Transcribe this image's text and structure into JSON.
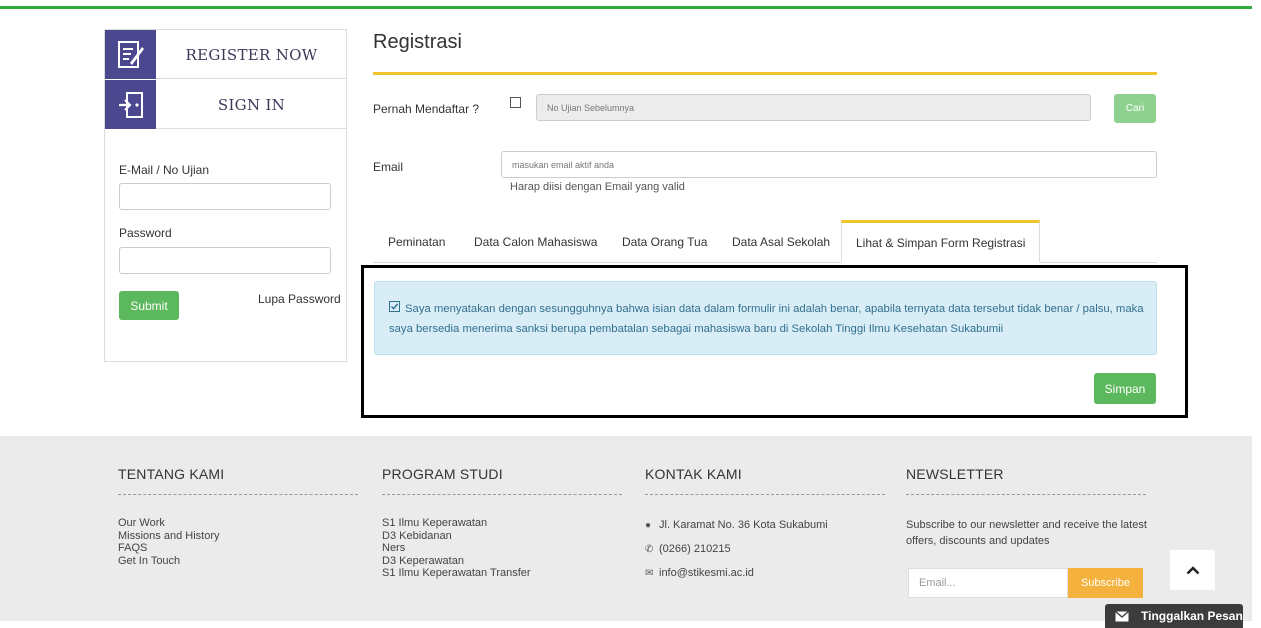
{
  "sidebar": {
    "register_label": "REGISTER NOW",
    "signin_label": "SIGN IN",
    "email_label": "E-Mail / No Ujian",
    "email_value": "",
    "password_label": "Password",
    "password_value": "",
    "submit_label": "Submit",
    "forgot_label": "Lupa Password"
  },
  "main": {
    "title": "Registrasi",
    "pernah_label": "Pernah Mendaftar ?",
    "pernah_checked": false,
    "no_ujian_placeholder": "No Ujian Sebelumnya",
    "cari_label": "Cari",
    "email_label": "Email",
    "email_placeholder": "masukan email aktif anda",
    "email_hint": "Harap diisi dengan Email yang valid",
    "tabs": [
      {
        "label": "Peminatan",
        "active": false
      },
      {
        "label": "Data Calon Mahasiswa",
        "active": false
      },
      {
        "label": "Data Orang Tua",
        "active": false
      },
      {
        "label": "Data Asal Sekolah",
        "active": false
      },
      {
        "label": "Lihat & Simpan Form Registrasi",
        "active": true
      }
    ],
    "declaration_checked": true,
    "declaration_text": "Saya menyatakan dengan sesungguhnya bahwa isian data dalam formulir ini adalah benar, apabila ternyata data tersebut tidak benar / palsu, maka saya bersedia menerima sanksi berupa pembatalan sebagai mahasiswa baru di Sekolah Tinggi Ilmu Kesehatan Sukabumii",
    "simpan_label": "Simpan"
  },
  "footer": {
    "about": {
      "title": "TENTANG KAMI",
      "items": [
        "Our Work",
        "Missions and History",
        "FAQS",
        "Get In Touch"
      ]
    },
    "programs": {
      "title": "PROGRAM STUDI",
      "items": [
        "S1 Ilmu Keperawatan",
        "D3 Kebidanan",
        "Ners",
        "D3 Keperawatan",
        "S1 Ilmu Keperawatan Transfer"
      ]
    },
    "contact": {
      "title": "KONTAK KAMI",
      "address": "Jl. Karamat No. 36 Kota Sukabumi",
      "phone": "(0266) 210215",
      "email": "info@stikesmi.ac.id"
    },
    "newsletter": {
      "title": "NEWSLETTER",
      "text": "Subscribe to our newsletter and receive the latest offers, discounts and updates",
      "placeholder": "Email...",
      "button": "Subscribe"
    }
  },
  "chat_label": "Tinggalkan Pesan",
  "colors": {
    "accent_green": "#2fae3b",
    "button_green": "#5cb85c",
    "accent_yellow": "#f0c52e",
    "sidebar_purple": "#4c4890",
    "subscribe_orange": "#f5b13d",
    "alert_bg": "#d9edf7"
  }
}
